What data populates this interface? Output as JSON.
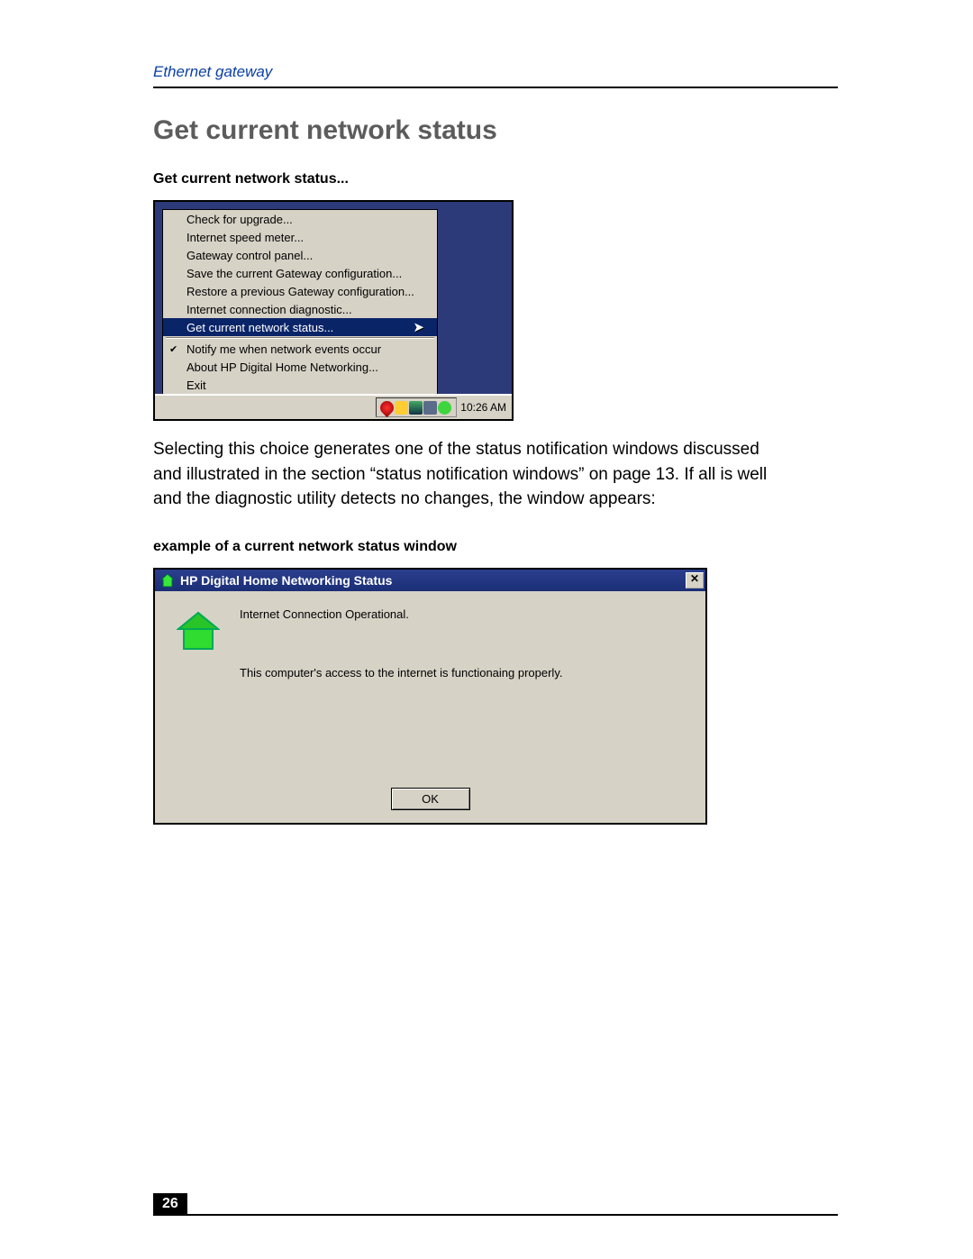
{
  "header": {
    "section": "Ethernet gateway"
  },
  "title": "Get current network status",
  "caption1": "Get current network status...",
  "menu": {
    "items": [
      {
        "label": "Check for upgrade...",
        "checked": false,
        "selected": false
      },
      {
        "label": "Internet speed meter...",
        "checked": false,
        "selected": false
      },
      {
        "label": "Gateway control panel...",
        "checked": false,
        "selected": false
      },
      {
        "label": "Save the current Gateway configuration...",
        "checked": false,
        "selected": false
      },
      {
        "label": "Restore a previous Gateway configuration...",
        "checked": false,
        "selected": false
      },
      {
        "label": "Internet connection diagnostic...",
        "checked": false,
        "selected": false
      },
      {
        "label": "Get current network status...",
        "checked": false,
        "selected": true
      },
      {
        "label": "Notify me when network events occur",
        "checked": true,
        "selected": false
      },
      {
        "label": "About HP Digital Home Networking...",
        "checked": false,
        "selected": false
      },
      {
        "label": "Exit",
        "checked": false,
        "selected": false
      }
    ],
    "clock": "10:26 AM"
  },
  "paragraph": "Selecting this choice generates one of the status notification windows discussed and illustrated in the section “status notification windows” on page 13. If all is well and the diagnostic utility detects no changes, the window appears:",
  "caption2": "example of a current network status window",
  "dialog": {
    "title": "HP Digital Home Networking Status",
    "line1": "Internet Connection Operational.",
    "line2": "This computer's access to the internet is functionaing properly.",
    "ok": "OK",
    "close": "✕"
  },
  "page_number": "26"
}
